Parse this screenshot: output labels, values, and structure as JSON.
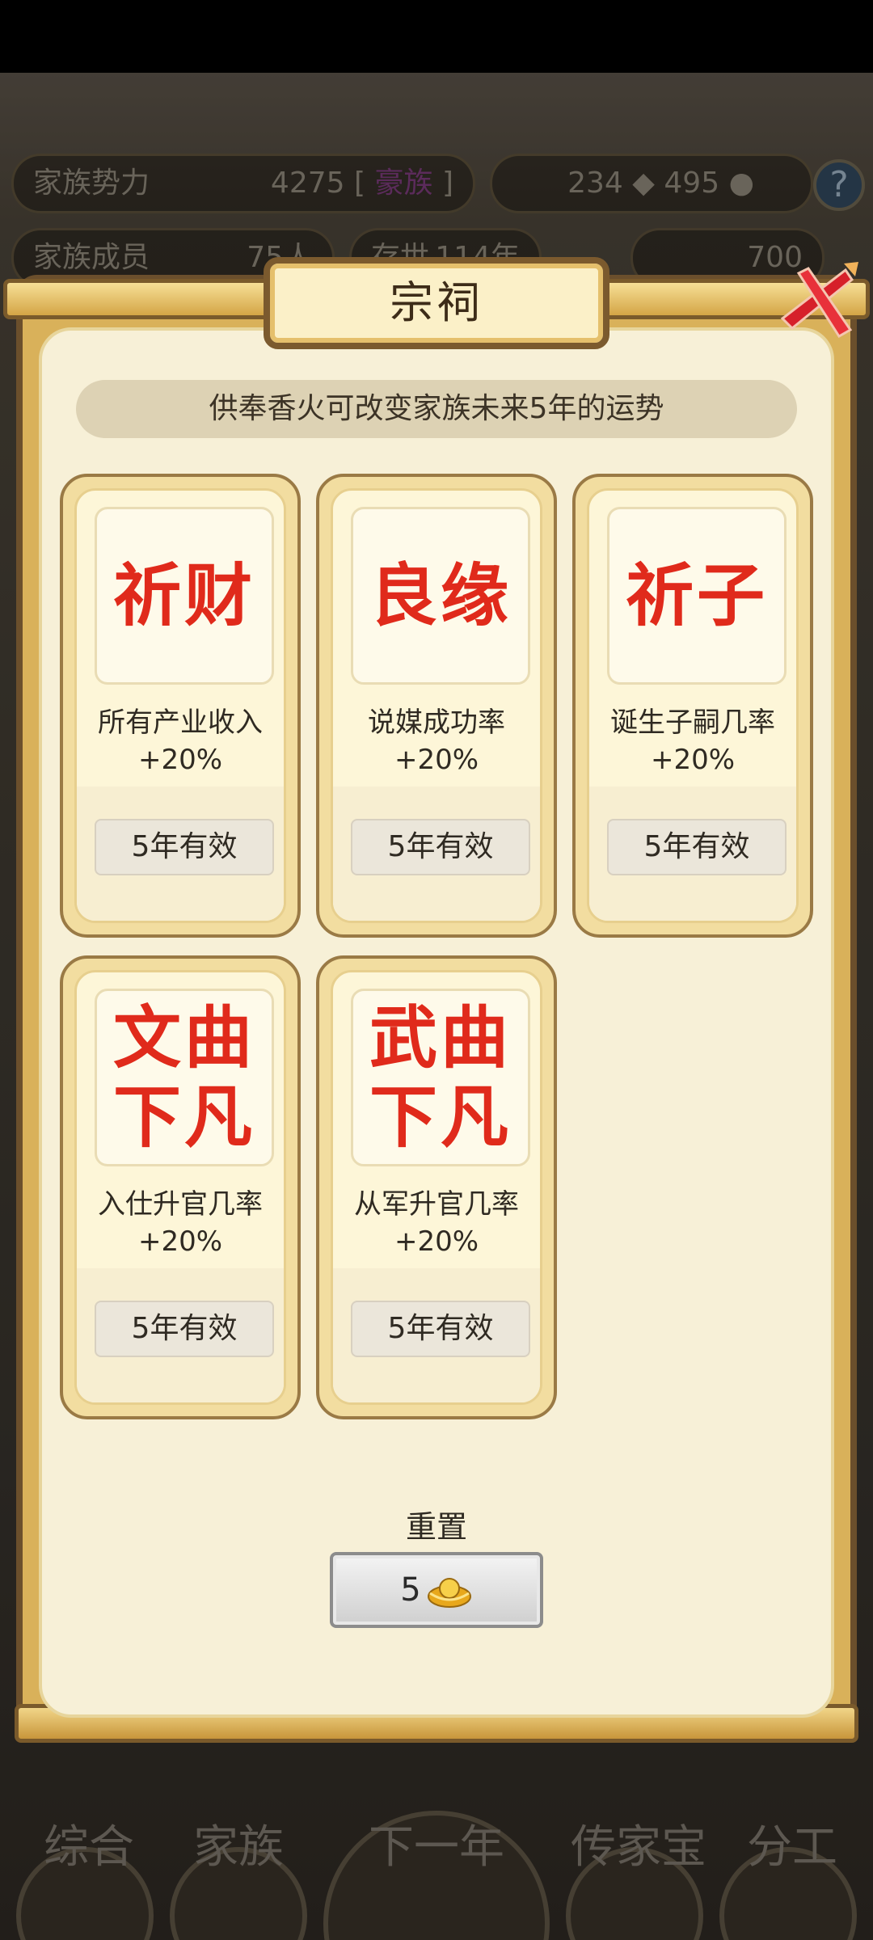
{
  "background": {
    "family_power_label": "家族势力",
    "family_power_value": "4275 [",
    "family_power_rank": "豪族",
    "family_power_close": "]",
    "currency_1": "234",
    "currency_2": "495",
    "members_label": "家族成员",
    "members_value": "75人",
    "existence_label": "存世",
    "existence_value": "114年",
    "gold_value": "700",
    "nav": [
      "综合",
      "家族",
      "下一年",
      "传家宝",
      "分工"
    ]
  },
  "dialog": {
    "title": "宗祠",
    "hint": "供奉香火可改变家族未来5年的运势",
    "cards": [
      {
        "title": "祈财",
        "desc": "所有产业收入+20%",
        "duration": "5年有效"
      },
      {
        "title": "良缘",
        "desc": "说媒成功率+20%",
        "duration": "5年有效"
      },
      {
        "title": "祈子",
        "desc": "诞生子嗣几率+20%",
        "duration": "5年有效"
      },
      {
        "title": "文曲下凡",
        "desc": "入仕升官几率+20%",
        "duration": "5年有效"
      },
      {
        "title": "武曲下凡",
        "desc": "从军升官几率+20%",
        "duration": "5年有效"
      }
    ],
    "reset_label": "重置",
    "reset_cost": "5"
  },
  "icons": {
    "close": "close-x-icon",
    "gold": "gold-ingot-icon",
    "help": "help-icon"
  },
  "colors": {
    "card_title": "#e02a1b",
    "dialog_bg": "#f7f0d7",
    "frame_gold": "#d9b15a"
  }
}
